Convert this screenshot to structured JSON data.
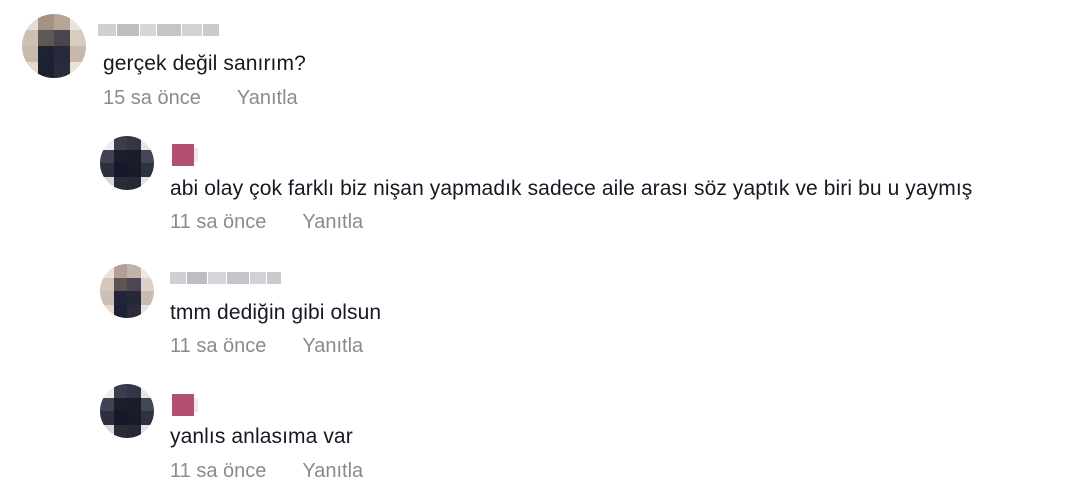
{
  "comments": [
    {
      "text": "gerçek değil sanırım?",
      "time": "15 sa önce",
      "reply_label": "Yanıtla"
    },
    {
      "text": "abi olay çok farklı biz nişan yapmadık sadece aile arası söz yaptık ve biri bu u yaymış",
      "time": "11 sa önce",
      "reply_label": "Yanıtla"
    },
    {
      "text": "tmm dediğin gibi olsun",
      "time": "11 sa önce",
      "reply_label": "Yanıtla"
    },
    {
      "text": "yanlıs anlasıma var",
      "time": "11 sa önce",
      "reply_label": "Yanıtla"
    }
  ],
  "colors": {
    "text": "#161823",
    "meta": "#8a8b91",
    "badge": "#b4506f"
  }
}
